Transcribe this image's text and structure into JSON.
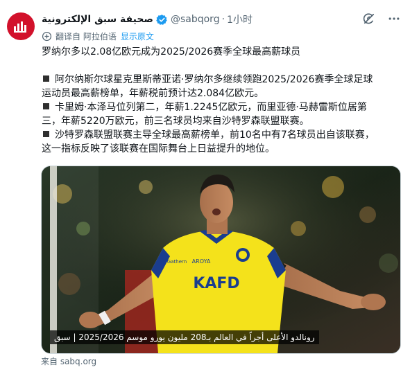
{
  "account": {
    "display_name": "صحيفة سبق الإلكترونية",
    "handle": "@sabqorg",
    "separator": "·",
    "time": "1小时",
    "verified": true,
    "avatar_color": "#d2112b"
  },
  "translation": {
    "from_label": "翻译自 阿拉伯语",
    "show_original": "显示原文"
  },
  "body": {
    "headline": "罗纳尔多以2.08亿欧元成为2025/2026赛季全球最高薪球员",
    "bullets": [
      {
        "line1": "阿尔纳斯尔球星克里斯蒂亚诺·罗纳尔多继续领跑2025/2026赛季全球足球",
        "line2": "运动员最高薪榜单，年薪税前预计达2.084亿欧元。"
      },
      {
        "line1": "卡里姆·本泽马位列第二，年薪1.2245亿欧元，而里亚德·马赫雷斯位居第",
        "line2": "三，年薪5220万欧元，前三名球员均来自沙特罗森联盟联赛。"
      },
      {
        "line1": "沙特罗森联盟联赛主导全球最高薪榜单，前10名中有7名球员出自该联赛，",
        "line2": "这一指标反映了该联赛在国际舞台上日益提升的地位。"
      }
    ]
  },
  "media": {
    "caption": "رونالدو الأعلى أجراً في العالم بـ208 مليون يورو موسم 2025/2026 | سبق",
    "jersey_sponsor": "KAFD",
    "jersey_brand_text": "Gathern",
    "jersey_chest_text": "AROYA",
    "kit_color": "#f4e21b",
    "kit_trim_color": "#1a3d8f"
  },
  "footer": {
    "source": "来自 sabq.org"
  },
  "icons": {
    "avatar": "sabq-logo-icon",
    "verified": "verified-badge-icon",
    "grok": "grok-icon",
    "more": "more-icon",
    "translate": "translate-icon"
  }
}
